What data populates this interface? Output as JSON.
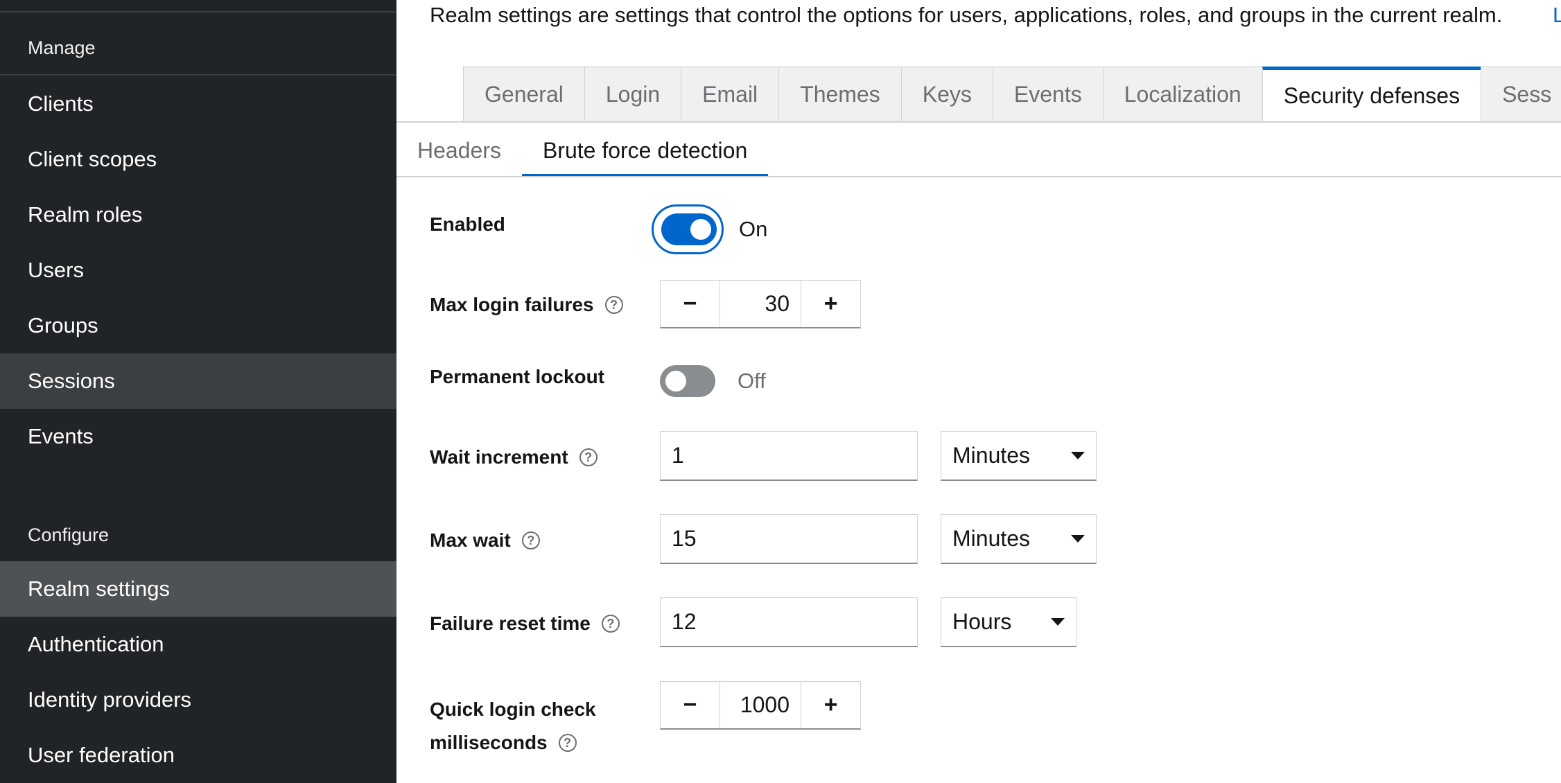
{
  "sidebar": {
    "manage_title": "Manage",
    "manage_items": [
      "Clients",
      "Client scopes",
      "Realm roles",
      "Users",
      "Groups",
      "Sessions",
      "Events"
    ],
    "configure_title": "Configure",
    "configure_items": [
      "Realm settings",
      "Authentication",
      "Identity providers",
      "User federation"
    ],
    "hovered_item": "Sessions",
    "active_item": "Realm settings"
  },
  "main": {
    "description": "Realm settings are settings that control the options for users, applications, roles, and groups in the current realm.",
    "description_link": "L",
    "tabs": [
      "General",
      "Login",
      "Email",
      "Themes",
      "Keys",
      "Events",
      "Localization",
      "Security defenses",
      "Sess"
    ],
    "active_tab": "Security defenses",
    "subtabs": [
      "Headers",
      "Brute force detection"
    ],
    "active_subtab": "Brute force detection"
  },
  "form": {
    "enabled": {
      "label": "Enabled",
      "state": "On"
    },
    "max_login_failures": {
      "label": "Max login failures",
      "value": "30",
      "minus": "−",
      "plus": "+"
    },
    "permanent_lockout": {
      "label": "Permanent lockout",
      "state": "Off"
    },
    "wait_increment": {
      "label": "Wait increment",
      "value": "1",
      "unit": "Minutes"
    },
    "max_wait": {
      "label": "Max wait",
      "value": "15",
      "unit": "Minutes"
    },
    "failure_reset_time": {
      "label": "Failure reset time",
      "value": "12",
      "unit": "Hours"
    },
    "quick_login_check": {
      "label_line1": "Quick login check",
      "label_line2": "milliseconds",
      "value": "1000",
      "minus": "−",
      "plus": "+"
    },
    "help_glyph": "?"
  },
  "colors": {
    "accent": "#0066cc",
    "sidebar_bg": "#212427",
    "sidebar_active": "#4f5255"
  }
}
